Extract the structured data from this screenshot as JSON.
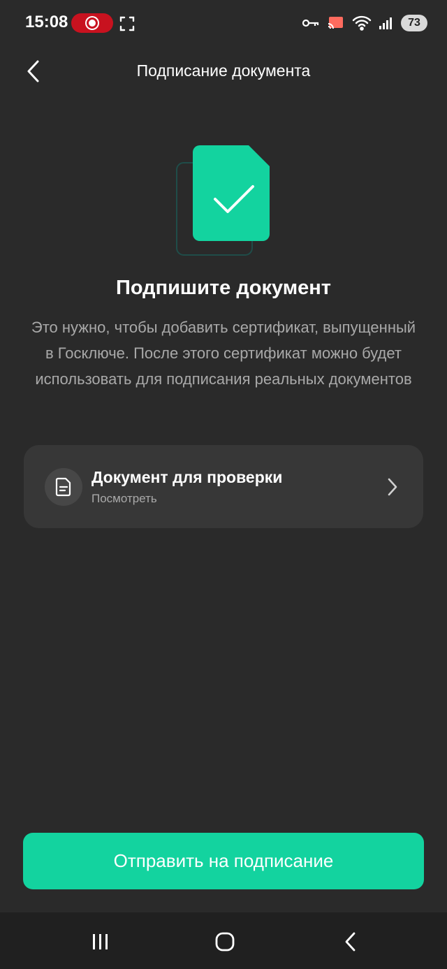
{
  "status_bar": {
    "time": "15:08",
    "battery": "73",
    "icons": [
      "record-icon",
      "fullscreen-icon",
      "key-icon",
      "cast-icon",
      "wifi-icon",
      "signal-icon",
      "battery-icon"
    ]
  },
  "header": {
    "title": "Подписание документа",
    "back_icon": "chevron-left-icon"
  },
  "illustration": {
    "icon": "document-check-icon",
    "accent_color": "#13d39f"
  },
  "main": {
    "heading": "Подпишите документ",
    "description": "Это нужно, чтобы добавить сертификат, выпущенный в Госключе. После этого сертификат можно будет использовать для подписания реальных документов"
  },
  "document_card": {
    "title": "Документ для проверки",
    "subtitle": "Посмотреть",
    "icon": "document-icon",
    "chevron": "chevron-right-icon"
  },
  "primary_action": {
    "label": "Отправить на подписание",
    "color": "#13d39f"
  },
  "nav_bar": {
    "items": [
      "recents-icon",
      "home-icon",
      "back-icon"
    ]
  }
}
